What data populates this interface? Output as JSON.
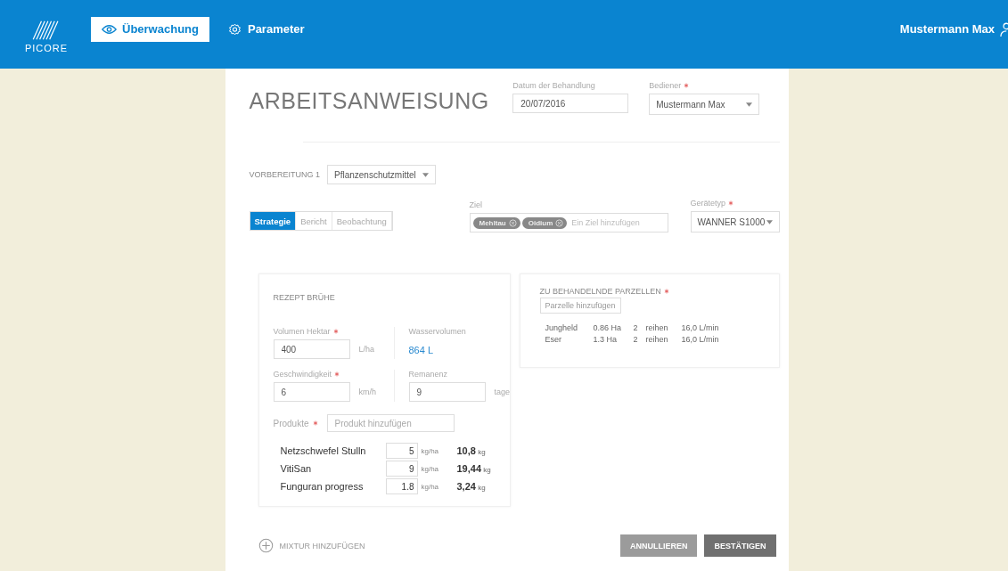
{
  "header": {
    "logo_text": "PICORE",
    "nav": [
      {
        "label": "Überwachung",
        "kind": "eye",
        "selected": true
      },
      {
        "label": "Parameter",
        "kind": "gear",
        "selected": false
      }
    ],
    "user": "Mustermann Max"
  },
  "form": {
    "title": "ARBEITSANWEISUNG",
    "date": {
      "label": "Datum der Behandlung",
      "value": "20/07/2016"
    },
    "operator": {
      "label": "Bediener",
      "required": true,
      "value": "Mustermann Max"
    },
    "preparation": {
      "label": "VORBEREITUNG 1",
      "value": "Pflanzenschutzmittel"
    },
    "tabs": [
      {
        "label": "Strategie",
        "selected": true
      },
      {
        "label": "Bericht",
        "selected": false
      },
      {
        "label": "Beobachtung",
        "selected": false
      }
    ],
    "target": {
      "label": "Ziel",
      "tags": [
        "Mehltau",
        "Oidium"
      ],
      "placeholder": "Ein Ziel hinzufügen"
    },
    "device_type": {
      "label": "Gerätetyp",
      "required": true,
      "value": "WANNER S1000"
    },
    "recipe": {
      "title": "REZEPT BRÜHE",
      "volume_hectare": {
        "label": "Volumen Hektar",
        "required": true,
        "value": "400",
        "unit": "L/ha"
      },
      "water_volume": {
        "label": "Wasservolumen",
        "value": "864 L"
      },
      "speed": {
        "label": "Geschwindigkeit",
        "required": true,
        "value": "6",
        "unit": "km/h"
      },
      "remanence": {
        "label": "Remanenz",
        "value": "9",
        "unit": "tage"
      },
      "products": {
        "label": "Produkte",
        "required": true,
        "placeholder": "Produkt hinzufügen"
      },
      "product_rows": [
        {
          "name": "Netzschwefel Stulln",
          "rate": "5",
          "unit": "kg/ha",
          "total": "**10,8** kg"
        },
        {
          "name": "VitiSan",
          "rate": "9",
          "unit": "kg/ha",
          "total": "**19,44** kg"
        },
        {
          "name": "Funguran progress",
          "rate": "1.8",
          "unit": "kg/ha",
          "total": "**3,24** kg"
        }
      ]
    },
    "parcels": {
      "title": "ZU BEHANDELNDE PARZELLEN",
      "required": true,
      "button": "Parzelle hinzufügen",
      "rows": [
        {
          "name": "Jungheld",
          "area": "0.86 Ha",
          "count": "2",
          "count_label": "reihen",
          "flow": "16,0 L/min"
        },
        {
          "name": "Eser",
          "area": "1.3 Ha",
          "count": "2",
          "count_label": "reihen",
          "flow": "16,0 L/min"
        }
      ]
    },
    "add_mixture": "MIXTUR HINZUFÜGEN",
    "buttons": [
      {
        "label": "ANNULLIEREN",
        "kind": "cancel"
      },
      {
        "label": "BESTÄTIGEN",
        "kind": "confirm"
      }
    ]
  }
}
